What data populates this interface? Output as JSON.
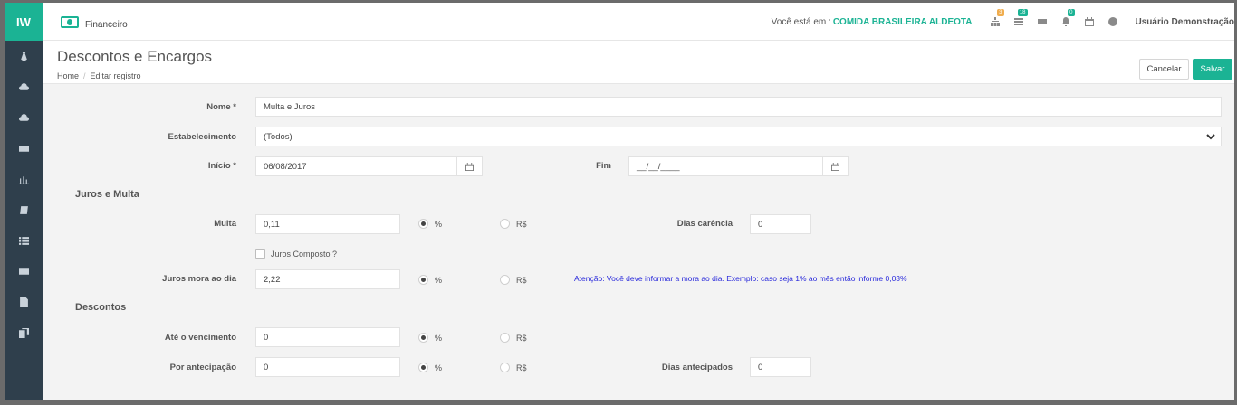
{
  "sidebar": {
    "logo": "IW",
    "items": [
      {
        "icon": "tie-icon"
      },
      {
        "icon": "cloud-download-icon"
      },
      {
        "icon": "cloud-upload-icon"
      },
      {
        "icon": "card-icon"
      },
      {
        "icon": "bar-chart-icon"
      },
      {
        "icon": "book-icon"
      },
      {
        "icon": "list-icon"
      },
      {
        "icon": "credit-card-icon"
      },
      {
        "icon": "file-text-icon"
      },
      {
        "icon": "copy-icon"
      }
    ]
  },
  "topbar": {
    "module_name": "Financeiro",
    "location_label": "Você está em :",
    "location_value": "COMIDA BRASILEIRA ALDEOTA",
    "badges": [
      {
        "icon": "sitemap-icon",
        "count": "3",
        "color": "#f0ad4e"
      },
      {
        "icon": "tasks-icon",
        "count": "18",
        "color": "#1bb394"
      },
      {
        "icon": "card-icon",
        "count": "",
        "color": ""
      },
      {
        "icon": "bell-icon",
        "count": "0",
        "color": "#1bb394"
      },
      {
        "icon": "calendar-icon",
        "count": "",
        "color": ""
      },
      {
        "icon": "help-icon",
        "count": "",
        "color": ""
      }
    ],
    "user_name": "Usuário Demonstração"
  },
  "header": {
    "title": "Descontos e Encargos",
    "breadcrumb_home": "Home",
    "breadcrumb_sep": "/",
    "breadcrumb_current": "Editar registro",
    "cancel_label": "Cancelar",
    "save_label": "Salvar"
  },
  "form": {
    "nome_label": "Nome *",
    "nome_value": "Multa e Juros",
    "estab_label": "Estabelecimento",
    "estab_value": "(Todos)",
    "inicio_label": "Início *",
    "inicio_value": "06/08/2017",
    "fim_label": "Fim",
    "fim_value": "__/__/____",
    "section_juros": "Juros e Multa",
    "multa_label": "Multa",
    "multa_value": "0,11",
    "pct_label": "%",
    "rs_label": "R$",
    "dias_carencia_label": "Dias carência",
    "dias_carencia_value": "0",
    "juros_composto_label": "Juros Composto ?",
    "juros_mora_label": "Juros mora ao dia",
    "juros_mora_value": "2,22",
    "note": "Atenção: Você deve informar a mora ao dia. Exemplo: caso seja 1% ao mês então informe 0,03%",
    "section_descontos": "Descontos",
    "ate_venc_label": "Até o vencimento",
    "ate_venc_value": "0",
    "antecipacao_label": "Por antecipação",
    "antecipacao_value": "0",
    "dias_antecipados_label": "Dias antecipados",
    "dias_antecipados_value": "0"
  },
  "colors": {
    "accent": "#1bb394",
    "sidebar": "#2f3f4c",
    "note": "#2a2adb"
  }
}
